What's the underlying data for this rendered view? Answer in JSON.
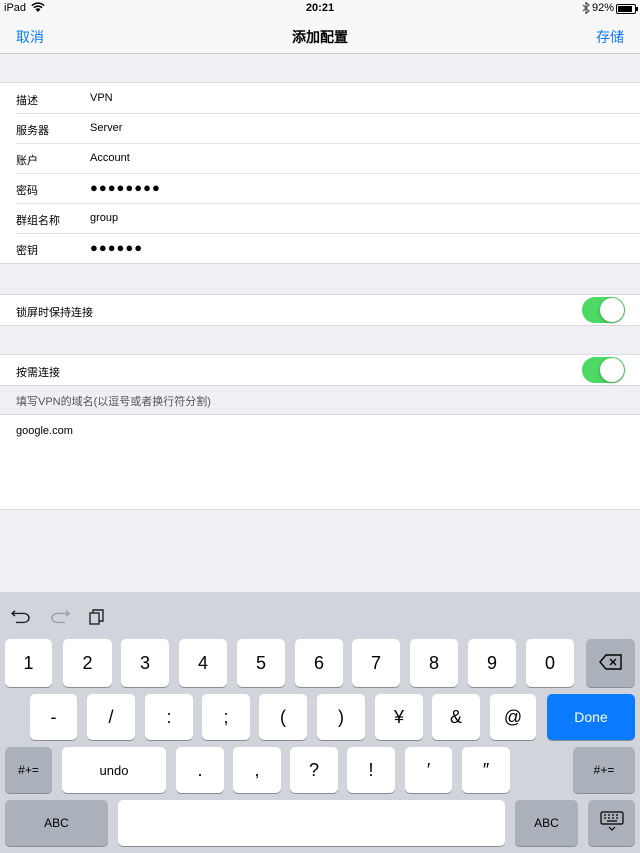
{
  "status": {
    "device": "iPad",
    "time": "20:21",
    "battery": "92%",
    "bluetooth_icon": "bluetooth-icon",
    "wifi_icon": "wifi-icon"
  },
  "nav": {
    "cancel": "取消",
    "title": "添加配置",
    "save": "存储"
  },
  "fields": [
    {
      "label": "描述",
      "value": "VPN"
    },
    {
      "label": "服务器",
      "value": "Server"
    },
    {
      "label": "账户",
      "value": "Account"
    },
    {
      "label": "密码",
      "value": "●●●●●●●●"
    },
    {
      "label": "群组名称",
      "value": "group"
    },
    {
      "label": "密钥",
      "value": "●●●●●●"
    }
  ],
  "lock_keep": {
    "label": "锁屏时保持连接",
    "on": true
  },
  "on_demand": {
    "label": "按需连接",
    "on": true
  },
  "domains": {
    "header": "填写VPN的域名(以逗号或者换行符分割)",
    "text": "google.com"
  },
  "keyboard": {
    "row1": [
      "1",
      "2",
      "3",
      "4",
      "5",
      "6",
      "7",
      "8",
      "9",
      "0"
    ],
    "row2": [
      "-",
      "/",
      ":",
      ";",
      "(",
      ")",
      "¥",
      "&",
      "@"
    ],
    "done": "Done",
    "row3_left": "#+=",
    "undo": "undo",
    "row3": [
      ".",
      ",",
      "?",
      "!",
      "′",
      "″"
    ],
    "row3_right": "#+=",
    "abc_left": "ABC",
    "abc_right": "ABC",
    "accent": "#0a7aff"
  }
}
